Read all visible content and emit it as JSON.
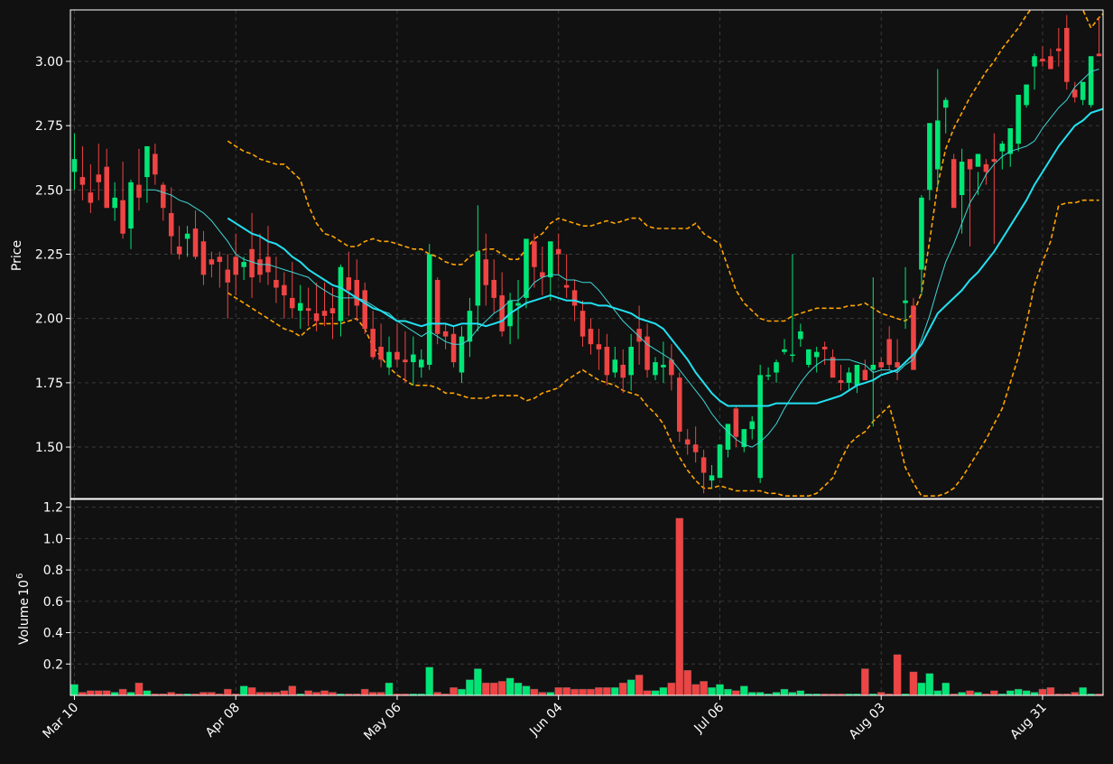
{
  "chart_data": {
    "type": "candlestick",
    "colors": {
      "up": "#00e676",
      "down": "#ef4444",
      "ma_fast": "#3fd6d6",
      "ma_slow": "#22e0f0",
      "band": "#ffa500",
      "grid": "#3a3a3a",
      "axis": "#ffffff",
      "background": "#111111"
    },
    "ylabel_price": "Price",
    "ylabel_volume": "Volume",
    "volume_exponent_label": "10",
    "volume_exponent_power": "6",
    "price_ylim": [
      1.3,
      3.2
    ],
    "volume_ylim": [
      0,
      1.25
    ],
    "price_ticks": [
      "1.50",
      "1.75",
      "2.00",
      "2.25",
      "2.50",
      "2.75",
      "3.00"
    ],
    "volume_ticks": [
      "0.2",
      "0.4",
      "0.6",
      "0.8",
      "1.0",
      "1.2"
    ],
    "x_ticks": [
      {
        "index": 0,
        "label": "Mar 10"
      },
      {
        "index": 20,
        "label": "Apr 08"
      },
      {
        "index": 40,
        "label": "May 06"
      },
      {
        "index": 60,
        "label": "Jun 04"
      },
      {
        "index": 80,
        "label": "Jul 06"
      },
      {
        "index": 100,
        "label": "Aug 03"
      },
      {
        "index": 120,
        "label": "Aug 31"
      }
    ],
    "n_bars": 128,
    "candles": [
      [
        2.57,
        2.72,
        2.5,
        2.62
      ],
      [
        2.55,
        2.67,
        2.46,
        2.52
      ],
      [
        2.49,
        2.6,
        2.41,
        2.45
      ],
      [
        2.56,
        2.68,
        2.46,
        2.53
      ],
      [
        2.59,
        2.66,
        2.45,
        2.43
      ],
      [
        2.43,
        2.53,
        2.38,
        2.47
      ],
      [
        2.46,
        2.61,
        2.31,
        2.33
      ],
      [
        2.35,
        2.54,
        2.27,
        2.53
      ],
      [
        2.52,
        2.66,
        2.42,
        2.47
      ],
      [
        2.55,
        2.65,
        2.45,
        2.67
      ],
      [
        2.64,
        2.68,
        2.52,
        2.56
      ],
      [
        2.52,
        2.53,
        2.38,
        2.43
      ],
      [
        2.41,
        2.51,
        2.25,
        2.32
      ],
      [
        2.28,
        2.36,
        2.23,
        2.25
      ],
      [
        2.31,
        2.36,
        2.24,
        2.33
      ],
      [
        2.35,
        2.42,
        2.23,
        2.24
      ],
      [
        2.3,
        2.34,
        2.13,
        2.17
      ],
      [
        2.23,
        2.26,
        2.16,
        2.21
      ],
      [
        2.24,
        2.26,
        2.12,
        2.22
      ],
      [
        2.19,
        2.25,
        2.0,
        2.14
      ],
      [
        2.24,
        2.33,
        2.09,
        2.17
      ],
      [
        2.2,
        2.24,
        2.15,
        2.22
      ],
      [
        2.27,
        2.41,
        2.08,
        2.16
      ],
      [
        2.23,
        2.33,
        2.14,
        2.17
      ],
      [
        2.24,
        2.36,
        2.13,
        2.18
      ],
      [
        2.15,
        2.24,
        2.06,
        2.12
      ],
      [
        2.13,
        2.18,
        2.0,
        2.09
      ],
      [
        2.08,
        2.22,
        2.0,
        2.04
      ],
      [
        2.03,
        2.13,
        1.96,
        2.06
      ],
      [
        2.04,
        2.12,
        1.97,
        2.03
      ],
      [
        2.02,
        2.14,
        1.95,
        1.99
      ],
      [
        2.03,
        2.14,
        1.97,
        2.01
      ],
      [
        2.04,
        2.12,
        1.92,
        2.02
      ],
      [
        1.99,
        2.21,
        1.93,
        2.2
      ],
      [
        2.16,
        2.26,
        2.01,
        2.11
      ],
      [
        2.15,
        2.23,
        1.99,
        2.05
      ],
      [
        2.11,
        2.14,
        1.94,
        1.96
      ],
      [
        1.96,
        2.03,
        1.84,
        1.85
      ],
      [
        1.89,
        1.98,
        1.81,
        1.84
      ],
      [
        1.81,
        1.93,
        1.78,
        1.87
      ],
      [
        1.87,
        1.98,
        1.81,
        1.84
      ],
      [
        1.84,
        1.95,
        1.75,
        1.83
      ],
      [
        1.83,
        1.93,
        1.74,
        1.86
      ],
      [
        1.81,
        1.88,
        1.77,
        1.84
      ],
      [
        1.82,
        2.29,
        1.8,
        2.25
      ],
      [
        2.15,
        2.16,
        1.9,
        1.94
      ],
      [
        1.95,
        1.98,
        1.88,
        1.93
      ],
      [
        1.94,
        1.97,
        1.81,
        1.83
      ],
      [
        1.79,
        1.97,
        1.75,
        1.93
      ],
      [
        1.91,
        2.08,
        1.85,
        2.03
      ],
      [
        2.05,
        2.44,
        1.95,
        2.26
      ],
      [
        2.23,
        2.33,
        2.05,
        2.13
      ],
      [
        2.15,
        2.23,
        2.02,
        2.08
      ],
      [
        2.09,
        2.18,
        1.93,
        1.95
      ],
      [
        1.97,
        2.1,
        1.9,
        2.07
      ],
      [
        2.05,
        2.15,
        1.92,
        2.06
      ],
      [
        2.08,
        2.3,
        2.04,
        2.31
      ],
      [
        2.3,
        2.33,
        2.12,
        2.2
      ],
      [
        2.18,
        2.28,
        2.09,
        2.16
      ],
      [
        2.16,
        2.26,
        2.07,
        2.3
      ],
      [
        2.27,
        2.33,
        2.17,
        2.25
      ],
      [
        2.13,
        2.25,
        2.08,
        2.12
      ],
      [
        2.11,
        2.15,
        1.99,
        2.05
      ],
      [
        2.03,
        2.07,
        1.89,
        1.93
      ],
      [
        1.96,
        2.0,
        1.86,
        1.9
      ],
      [
        1.9,
        1.96,
        1.8,
        1.88
      ],
      [
        1.89,
        1.94,
        1.74,
        1.78
      ],
      [
        1.79,
        1.89,
        1.77,
        1.84
      ],
      [
        1.82,
        1.88,
        1.71,
        1.77
      ],
      [
        1.78,
        1.94,
        1.72,
        1.89
      ],
      [
        1.96,
        2.05,
        1.82,
        1.91
      ],
      [
        1.93,
        1.98,
        1.77,
        1.8
      ],
      [
        1.78,
        1.85,
        1.76,
        1.83
      ],
      [
        1.81,
        1.91,
        1.75,
        1.82
      ],
      [
        1.84,
        1.9,
        1.72,
        1.78
      ],
      [
        1.77,
        1.79,
        1.52,
        1.56
      ],
      [
        1.53,
        1.57,
        1.47,
        1.51
      ],
      [
        1.51,
        1.58,
        1.44,
        1.48
      ],
      [
        1.46,
        1.49,
        1.32,
        1.4
      ],
      [
        1.37,
        1.43,
        1.34,
        1.39
      ],
      [
        1.38,
        1.5,
        1.38,
        1.51
      ],
      [
        1.49,
        1.59,
        1.46,
        1.59
      ],
      [
        1.65,
        1.66,
        1.5,
        1.54
      ],
      [
        1.5,
        1.53,
        1.48,
        1.57
      ],
      [
        1.57,
        1.62,
        1.53,
        1.6
      ],
      [
        1.38,
        1.82,
        1.36,
        1.78
      ],
      [
        1.78,
        1.81,
        1.76,
        1.78
      ],
      [
        1.79,
        1.84,
        1.75,
        1.83
      ],
      [
        1.87,
        1.92,
        1.86,
        1.88
      ],
      [
        1.86,
        2.25,
        1.83,
        1.86
      ],
      [
        1.92,
        1.98,
        1.89,
        1.95
      ],
      [
        1.82,
        1.88,
        1.81,
        1.88
      ],
      [
        1.85,
        1.89,
        1.79,
        1.87
      ],
      [
        1.89,
        1.91,
        1.82,
        1.88
      ],
      [
        1.85,
        1.88,
        1.81,
        1.77
      ],
      [
        1.76,
        1.82,
        1.72,
        1.75
      ],
      [
        1.75,
        1.81,
        1.72,
        1.79
      ],
      [
        1.74,
        1.79,
        1.71,
        1.82
      ],
      [
        1.8,
        1.84,
        1.77,
        1.76
      ],
      [
        1.8,
        2.16,
        1.58,
        1.82
      ],
      [
        1.83,
        1.85,
        1.8,
        1.81
      ],
      [
        1.92,
        1.97,
        1.8,
        1.82
      ],
      [
        1.83,
        1.92,
        1.76,
        1.81
      ],
      [
        2.06,
        2.2,
        1.96,
        2.07
      ],
      [
        2.05,
        2.08,
        1.8,
        1.8
      ],
      [
        2.19,
        2.48,
        2.09,
        2.47
      ],
      [
        2.5,
        2.73,
        2.46,
        2.76
      ],
      [
        2.58,
        2.97,
        2.51,
        2.77
      ],
      [
        2.82,
        2.86,
        2.72,
        2.85
      ],
      [
        2.62,
        2.64,
        2.56,
        2.43
      ],
      [
        2.48,
        2.66,
        2.33,
        2.61
      ],
      [
        2.62,
        2.6,
        2.28,
        2.58
      ],
      [
        2.59,
        2.57,
        2.48,
        2.64
      ],
      [
        2.6,
        2.62,
        2.52,
        2.57
      ],
      [
        2.62,
        2.72,
        2.29,
        2.61
      ],
      [
        2.65,
        2.69,
        2.58,
        2.68
      ],
      [
        2.64,
        2.74,
        2.59,
        2.74
      ],
      [
        2.68,
        2.87,
        2.65,
        2.87
      ],
      [
        2.83,
        2.9,
        2.82,
        2.91
      ],
      [
        2.98,
        3.03,
        2.89,
        3.02
      ],
      [
        3.01,
        3.06,
        2.98,
        3.0
      ],
      [
        3.02,
        3.05,
        2.97,
        2.97
      ],
      [
        3.05,
        3.13,
        2.98,
        3.04
      ],
      [
        3.13,
        3.18,
        2.89,
        2.92
      ],
      [
        2.89,
        2.92,
        2.84,
        2.86
      ],
      [
        2.85,
        2.92,
        2.83,
        2.92
      ],
      [
        2.83,
        3.02,
        2.82,
        3.02
      ],
      [
        3.03,
        3.17,
        3.03,
        3.02
      ],
      [
        3.05,
        3.11,
        2.93,
        2.96
      ]
    ],
    "volumes": [
      0.07,
      0.02,
      0.03,
      0.03,
      0.03,
      0.02,
      0.04,
      0.02,
      0.08,
      0.03,
      0.01,
      0.01,
      0.02,
      0.01,
      0.01,
      0.01,
      0.02,
      0.02,
      0.01,
      0.04,
      0.01,
      0.06,
      0.05,
      0.02,
      0.02,
      0.02,
      0.03,
      0.06,
      0.01,
      0.03,
      0.02,
      0.03,
      0.02,
      0.01,
      0.01,
      0.01,
      0.04,
      0.02,
      0.02,
      0.08,
      0.01,
      0.01,
      0.01,
      0.01,
      0.18,
      0.02,
      0.01,
      0.05,
      0.04,
      0.1,
      0.17,
      0.08,
      0.08,
      0.09,
      0.11,
      0.08,
      0.06,
      0.04,
      0.02,
      0.02,
      0.05,
      0.05,
      0.04,
      0.04,
      0.04,
      0.05,
      0.05,
      0.05,
      0.08,
      0.1,
      0.13,
      0.03,
      0.03,
      0.05,
      0.08,
      1.13,
      0.16,
      0.07,
      0.09,
      0.05,
      0.07,
      0.04,
      0.03,
      0.06,
      0.02,
      0.02,
      0.01,
      0.02,
      0.04,
      0.02,
      0.03,
      0.01,
      0.01,
      0.01,
      0.01,
      0.01,
      0.01,
      0.01,
      0.17,
      0.01,
      0.02,
      0.01,
      0.26,
      0.01,
      0.15,
      0.08,
      0.14,
      0.03,
      0.08,
      0.01,
      0.02,
      0.03,
      0.02,
      0.01,
      0.03,
      0.01,
      0.03,
      0.04,
      0.03,
      0.02,
      0.04,
      0.05,
      0.01,
      0.01,
      0.02,
      0.05,
      0.01,
      0.01
    ],
    "ma_fast": [
      null,
      null,
      null,
      null,
      null,
      null,
      null,
      null,
      null,
      2.5,
      2.5,
      2.49,
      2.48,
      2.46,
      2.45,
      2.43,
      2.41,
      2.38,
      2.34,
      2.3,
      2.25,
      2.23,
      2.22,
      2.21,
      2.21,
      2.2,
      2.19,
      2.18,
      2.17,
      2.16,
      2.13,
      2.11,
      2.09,
      2.08,
      2.08,
      2.08,
      2.07,
      2.05,
      2.03,
      2.02,
      1.99,
      1.97,
      1.95,
      1.93,
      1.95,
      1.93,
      1.91,
      1.9,
      1.9,
      1.92,
      1.96,
      1.99,
      2.02,
      2.04,
      2.07,
      2.07,
      2.1,
      2.14,
      2.16,
      2.17,
      2.17,
      2.15,
      2.15,
      2.14,
      2.14,
      2.11,
      2.07,
      2.03,
      1.99,
      1.96,
      1.93,
      1.9,
      1.88,
      1.86,
      1.84,
      1.8,
      1.76,
      1.72,
      1.68,
      1.63,
      1.59,
      1.56,
      1.53,
      1.51,
      1.5,
      1.52,
      1.55,
      1.59,
      1.65,
      1.7,
      1.75,
      1.79,
      1.82,
      1.84,
      1.84,
      1.84,
      1.84,
      1.83,
      1.82,
      1.79,
      1.8,
      1.8,
      1.79,
      1.82,
      1.84,
      1.92,
      2.01,
      2.12,
      2.22,
      2.29,
      2.37,
      2.45,
      2.5,
      2.56,
      2.6,
      2.63,
      2.65,
      2.66,
      2.67,
      2.69,
      2.74,
      2.78,
      2.82,
      2.85,
      2.9,
      2.93,
      2.96,
      2.97
    ],
    "ma_slow": [
      null,
      null,
      null,
      null,
      null,
      null,
      null,
      null,
      null,
      null,
      null,
      null,
      null,
      null,
      null,
      null,
      null,
      null,
      null,
      2.39,
      2.37,
      2.35,
      2.33,
      2.32,
      2.3,
      2.29,
      2.27,
      2.24,
      2.22,
      2.19,
      2.17,
      2.15,
      2.13,
      2.12,
      2.1,
      2.08,
      2.06,
      2.04,
      2.03,
      2.01,
      1.99,
      1.99,
      1.98,
      1.97,
      1.98,
      1.98,
      1.98,
      1.97,
      1.98,
      1.98,
      1.98,
      1.97,
      1.98,
      1.99,
      2.02,
      2.04,
      2.06,
      2.07,
      2.08,
      2.09,
      2.08,
      2.07,
      2.07,
      2.06,
      2.06,
      2.05,
      2.05,
      2.04,
      2.03,
      2.02,
      2.0,
      1.99,
      1.98,
      1.96,
      1.92,
      1.88,
      1.84,
      1.79,
      1.75,
      1.71,
      1.68,
      1.66,
      1.66,
      1.66,
      1.66,
      1.66,
      1.66,
      1.67,
      1.67,
      1.67,
      1.67,
      1.67,
      1.67,
      1.68,
      1.69,
      1.7,
      1.72,
      1.74,
      1.75,
      1.76,
      1.78,
      1.79,
      1.8,
      1.83,
      1.86,
      1.9,
      1.96,
      2.02,
      2.05,
      2.08,
      2.11,
      2.15,
      2.18,
      2.22,
      2.26,
      2.31,
      2.36,
      2.41,
      2.46,
      2.52,
      2.57,
      2.62,
      2.67,
      2.71,
      2.75,
      2.77,
      2.8,
      2.81,
      2.82,
      2.83
    ],
    "band_upper": [
      null,
      null,
      null,
      null,
      null,
      null,
      null,
      null,
      null,
      null,
      null,
      null,
      null,
      null,
      null,
      null,
      null,
      null,
      null,
      2.69,
      2.67,
      2.65,
      2.64,
      2.62,
      2.61,
      2.6,
      2.6,
      2.57,
      2.54,
      2.44,
      2.37,
      2.33,
      2.32,
      2.3,
      2.28,
      2.28,
      2.3,
      2.31,
      2.3,
      2.3,
      2.29,
      2.28,
      2.27,
      2.27,
      2.25,
      2.24,
      2.22,
      2.21,
      2.21,
      2.24,
      2.26,
      2.27,
      2.27,
      2.25,
      2.23,
      2.23,
      2.27,
      2.31,
      2.33,
      2.37,
      2.39,
      2.38,
      2.37,
      2.36,
      2.36,
      2.37,
      2.38,
      2.37,
      2.38,
      2.39,
      2.39,
      2.36,
      2.35,
      2.35,
      2.35,
      2.35,
      2.35,
      2.37,
      2.33,
      2.31,
      2.29,
      2.2,
      2.11,
      2.06,
      2.03,
      2.0,
      1.99,
      1.99,
      1.99,
      2.01,
      2.02,
      2.03,
      2.04,
      2.04,
      2.04,
      2.04,
      2.05,
      2.05,
      2.06,
      2.04,
      2.02,
      2.01,
      2.0,
      1.99,
      2.02,
      2.1,
      2.3,
      2.52,
      2.66,
      2.74,
      2.8,
      2.86,
      2.91,
      2.96,
      3.0,
      3.05,
      3.09,
      3.13,
      3.18,
      3.22,
      3.27,
      3.3,
      3.33,
      3.35,
      3.27,
      3.2,
      3.13,
      3.17,
      3.2,
      3.23
    ],
    "band_lower": [
      null,
      null,
      null,
      null,
      null,
      null,
      null,
      null,
      null,
      null,
      null,
      null,
      null,
      null,
      null,
      null,
      null,
      null,
      null,
      2.1,
      2.08,
      2.06,
      2.04,
      2.02,
      2.0,
      1.98,
      1.96,
      1.95,
      1.93,
      1.96,
      1.98,
      1.98,
      1.98,
      1.98,
      1.99,
      2.0,
      1.96,
      1.89,
      1.85,
      1.81,
      1.78,
      1.76,
      1.74,
      1.74,
      1.74,
      1.73,
      1.71,
      1.71,
      1.7,
      1.69,
      1.69,
      1.69,
      1.7,
      1.7,
      1.7,
      1.7,
      1.68,
      1.69,
      1.71,
      1.72,
      1.73,
      1.76,
      1.78,
      1.8,
      1.78,
      1.76,
      1.75,
      1.74,
      1.72,
      1.71,
      1.7,
      1.66,
      1.63,
      1.59,
      1.52,
      1.46,
      1.41,
      1.37,
      1.34,
      1.34,
      1.35,
      1.34,
      1.33,
      1.33,
      1.33,
      1.33,
      1.32,
      1.32,
      1.31,
      1.31,
      1.31,
      1.31,
      1.32,
      1.35,
      1.38,
      1.45,
      1.51,
      1.54,
      1.56,
      1.6,
      1.63,
      1.66,
      1.55,
      1.42,
      1.36,
      1.31,
      1.31,
      1.31,
      1.32,
      1.34,
      1.38,
      1.43,
      1.48,
      1.53,
      1.59,
      1.65,
      1.75,
      1.85,
      1.98,
      2.13,
      2.22,
      2.3,
      2.44,
      2.45,
      2.45,
      2.46,
      2.46,
      2.46
    ]
  }
}
